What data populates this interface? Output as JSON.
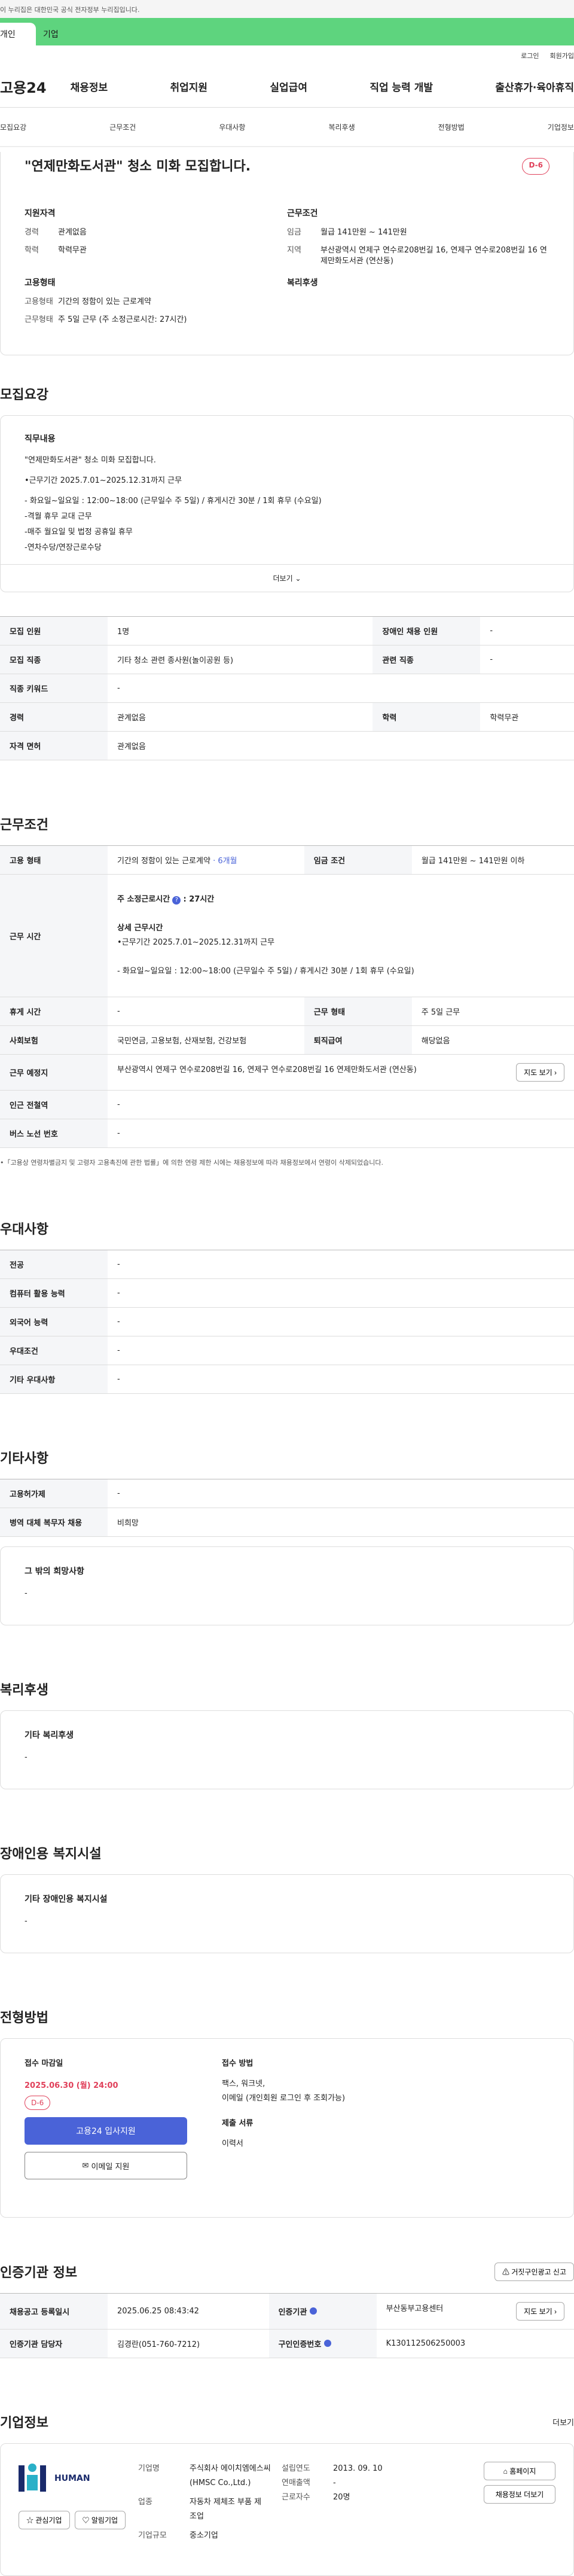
{
  "gov_banner": "이 누리집은 대한민국 공식 전자정부 누리집입니다.",
  "audience_tabs": [
    "개인",
    "기업"
  ],
  "utility": [
    "로그인",
    "회원가입"
  ],
  "logo": "고용24",
  "gnb": [
    "채용정보",
    "취업지원",
    "실업급여",
    "직업 능력 개발",
    "출산휴가·육아휴직"
  ],
  "subnav": [
    "모집요강",
    "근무조건",
    "우대사항",
    "복리후생",
    "전형방법",
    "기업정보"
  ],
  "title": "\"연제만화도서관\" 청소 미화 모집합니다.",
  "dday": "D-6",
  "summary": {
    "qualification_label": "지원자격",
    "career_label": "경력",
    "career": "관계없음",
    "edu_label": "학력",
    "edu": "학력무관",
    "condition_label": "근무조건",
    "wage_label": "임금",
    "wage": "월급 141만원 ~ 141만원",
    "region_label": "지역",
    "region": "부산광역시 연제구 연수로208번길 16, 연제구 연수로208번길 16 연제만화도서관 (연산동)",
    "employ_label": "고용형태",
    "employ_type_label": "고용형태",
    "employ_type": "기간의 정함이 있는 근로계약",
    "work_type_label": "근무형태",
    "work_type": "주 5일 근무 (주 소정근로시간: 27시간)",
    "welfare_label": "복리후생"
  },
  "recruit": {
    "section": "모집요강",
    "job_title": "직무내용",
    "lines": [
      "\"연제만화도서관\" 청소 미화 모집합니다.",
      "",
      "•근무기간 2025.7.01~2025.12.31까지 근무",
      "",
      "- 화요일~일요일 : 12:00~18:00 (근무일수 주 5일) / 휴게시간 30분 / 1회 휴무 (수요일)",
      "-격월 휴무 교대 근무",
      "-매주 월요일 및 법정 공휴일 휴무",
      "-연차수당/연장근로수당"
    ],
    "more": "더보기"
  },
  "recruit_table": [
    [
      "모집 인원",
      "1명",
      "장애인 채용 인원",
      "-"
    ],
    [
      "모집 직종",
      "기타 청소 관련 종사원(놀이공원 등)",
      "관련 직종",
      "-"
    ],
    [
      "직종 키워드",
      "-",
      "",
      ""
    ],
    [
      "경력",
      "관계없음",
      "학력",
      "학력무관"
    ],
    [
      "자격 면허",
      "관계없음",
      "",
      ""
    ]
  ],
  "work": {
    "section": "근무조건",
    "employ_label": "고용 형태",
    "employ": "기간의 정함이 있는 근로계약",
    "employ_term": "· 6개월",
    "wage_label": "임금 조건",
    "wage": "월급 141만원 ~ 141만원 이하",
    "hours_label": "근무 시간",
    "hours_total": "주 소정근로시간",
    "hours_total_val": ": 27시간",
    "hours_detail_title": "상세 근무시간",
    "hours_lines": [
      "•근무기간 2025.7.01~2025.12.31까지 근무",
      "",
      "- 화요일~일요일 : 12:00~18:00 (근무일수 주 5일) / 휴게시간 30분 / 1회 휴무 (수요일)"
    ],
    "rest_label": "휴게 시간",
    "rest": "-",
    "form_label": "근무 형태",
    "form": "주 5일 근무",
    "insurance_label": "사회보험",
    "insurance": "국민연금, 고용보험, 산재보험, 건강보험",
    "retire_label": "퇴직급여",
    "retire": "해당없음",
    "place_label": "근무 예정지",
    "place": "부산광역시 연제구 연수로208번길 16, 연제구 연수로208번길 16 연제만화도서관 (연산동)",
    "map": "지도 보기",
    "subway_label": "인근 전철역",
    "subway": "-",
    "bus_label": "버스 노선 번호",
    "bus": "-",
    "notice": "•「고용상 연령차별금지 및 고령자 고용촉진에 관한 법률」에 의한 연령 제한 시에는 채용정보에 따라 채용정보에서 연령이 삭제되었습니다."
  },
  "prefer": {
    "section": "우대사항",
    "rows": [
      [
        "전공",
        "-"
      ],
      [
        "컴퓨터 활용 능력",
        "-"
      ],
      [
        "외국어 능력",
        "-"
      ],
      [
        "우대조건",
        "-"
      ],
      [
        "기타 우대사항",
        "-"
      ]
    ]
  },
  "etc": {
    "section": "기타사항",
    "rows": [
      [
        "고용허가제",
        "-"
      ],
      [
        "병역 대체 복무자 채용",
        "비희망"
      ]
    ],
    "other_title": "그 밖의 희망사항",
    "other": "-"
  },
  "welfare": {
    "section": "복리후생",
    "title": "기타 복리후생",
    "value": "-"
  },
  "disabled": {
    "section": "장애인용 복지시설",
    "title": "기타 장애인용 복지시설",
    "value": "-"
  },
  "selection": {
    "section": "전형방법",
    "deadline_label": "접수 마감일",
    "deadline": "2025.06.30 (월) 24:00",
    "dday": "D-6",
    "apply_button": "고용24 입사지원",
    "email_button": "이메일 지원",
    "method_label": "접수 방법",
    "method_lines": [
      "팩스, 워크넷,",
      "이메일 (개인회원 로그인 후 조회가능)"
    ],
    "docs_label": "제출 서류",
    "docs": "이력서"
  },
  "agency": {
    "section": "인증기관 정보",
    "report_button": "거짓구인광고 신고",
    "rows": [
      [
        "채용공고 등록일시",
        "2025.06.25 08:43:42",
        "인증기관",
        "부산동부고용센터"
      ],
      [
        "인증기관 담당자",
        "김경란(051-760-7212)",
        "구인인증번호",
        "K130112506250003"
      ]
    ],
    "map": "지도 보기"
  },
  "company": {
    "section": "기업정보",
    "more": "더보기",
    "logo_text": "HUMAN",
    "fav": "관심기업",
    "alarm": "알림기업",
    "name_label": "기업명",
    "name": "주식회사 에이치엠에스씨 (HMSC Co.,Ltd.)",
    "industry_label": "업종",
    "industry": "자동차 제체조 부품 제조업",
    "size_label": "기업규모",
    "size": "중소기업",
    "founded_label": "설립연도",
    "founded": "2013. 09. 10",
    "sales_label": "연매출액",
    "sales": "-",
    "staff_label": "근로자수",
    "staff": "20명",
    "homepage": "홈페이지",
    "other_jobs": "채용정보 더보기"
  }
}
